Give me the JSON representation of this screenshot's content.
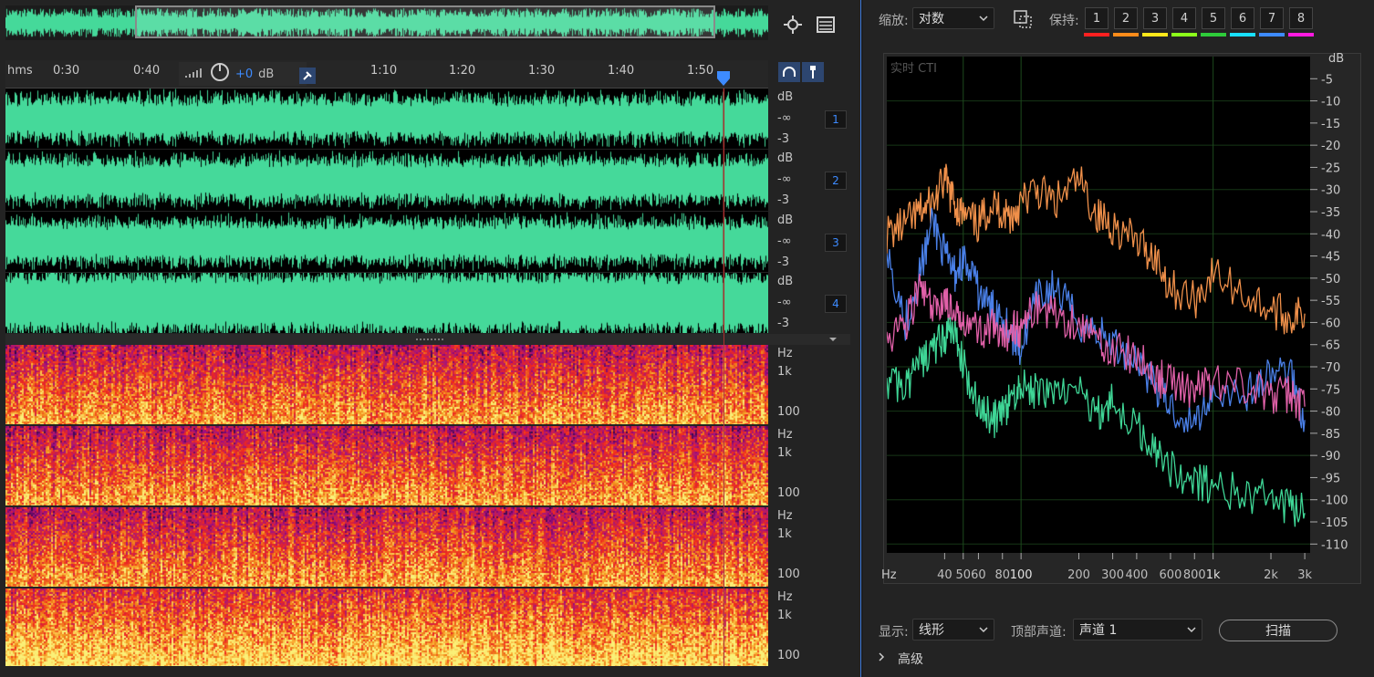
{
  "editor": {
    "ruler": {
      "unit": "hms",
      "ticks": [
        "0:30",
        "0:40",
        "1:10",
        "1:20",
        "1:30",
        "1:40",
        "1:50"
      ]
    },
    "hud": {
      "gain": "+0",
      "unit": "dB"
    },
    "waveform_channels": [
      {
        "number": "1",
        "scale": [
          "dB",
          "-∞",
          "-3"
        ]
      },
      {
        "number": "2",
        "scale": [
          "dB",
          "-∞",
          "-3"
        ]
      },
      {
        "number": "3",
        "scale": [
          "dB",
          "-∞",
          "-3"
        ]
      },
      {
        "number": "4",
        "scale": [
          "dB",
          "-∞",
          "-3"
        ]
      }
    ],
    "spectral_channels": [
      {
        "scale": [
          "Hz",
          "1k",
          "100"
        ]
      },
      {
        "scale": [
          "Hz",
          "1k",
          "100"
        ]
      },
      {
        "scale": [
          "Hz",
          "1k",
          "100"
        ]
      },
      {
        "scale": [
          "Hz",
          "1k",
          "100"
        ]
      }
    ],
    "waveform_color": "#45d99a",
    "icons": [
      "zoom-icon",
      "list-icon",
      "headphones-icon",
      "pin-icon",
      "meter-icon",
      "knob-icon"
    ]
  },
  "analysis": {
    "zoom_label": "缩放:",
    "zoom_value": "对数",
    "hold_label": "保持:",
    "holds": [
      {
        "n": "1",
        "color": "#ff2020"
      },
      {
        "n": "2",
        "color": "#ff8c1a"
      },
      {
        "n": "3",
        "color": "#ffe81a"
      },
      {
        "n": "4",
        "color": "#8cff1a"
      },
      {
        "n": "5",
        "color": "#2ecc3a"
      },
      {
        "n": "6",
        "color": "#18e0ff"
      },
      {
        "n": "7",
        "color": "#3d8bff"
      },
      {
        "n": "8",
        "color": "#ff1ae0"
      }
    ],
    "overlay_text": "实时 CTI",
    "display_label": "显示:",
    "display_value": "线形",
    "top_channel_label": "顶部声道:",
    "top_channel_value": "声道 1",
    "scan_button": "扫描",
    "advanced": "高级"
  },
  "chart_data": {
    "type": "line",
    "xlabel": "Hz",
    "ylabel": "dB",
    "x_scale": "log",
    "x_ticks": [
      "40",
      "50",
      "60",
      "80",
      "100",
      "200",
      "300",
      "400",
      "600",
      "800",
      "1k",
      "2k",
      "3k"
    ],
    "y_ticks": [
      "-5",
      "-10",
      "-15",
      "-20",
      "-25",
      "-30",
      "-35",
      "-40",
      "-45",
      "-50",
      "-55",
      "-60",
      "-65",
      "-70",
      "-75",
      "-80",
      "-85",
      "-90",
      "-95",
      "-100",
      "-105",
      "-110"
    ],
    "xlim": [
      20,
      3200
    ],
    "ylim": [
      -112,
      0
    ],
    "grid": true,
    "series": [
      {
        "color": "#f0904a",
        "x": [
          20,
          25,
          30,
          35,
          40,
          45,
          50,
          60,
          70,
          80,
          90,
          100,
          120,
          150,
          200,
          250,
          300,
          400,
          500,
          600,
          800,
          1000,
          1500,
          2000,
          2500,
          3000
        ],
        "y": [
          -40,
          -38,
          -35,
          -33,
          -28,
          -33,
          -36,
          -38,
          -33,
          -35,
          -36,
          -33,
          -30,
          -33,
          -28,
          -36,
          -38,
          -42,
          -45,
          -52,
          -55,
          -49,
          -54,
          -57,
          -59,
          -58
        ]
      },
      {
        "color": "#4a80e8",
        "x": [
          20,
          25,
          30,
          35,
          40,
          45,
          50,
          60,
          70,
          80,
          90,
          100,
          120,
          150,
          200,
          250,
          300,
          400,
          500,
          600,
          800,
          1000,
          1500,
          2000,
          2500,
          3000
        ],
        "y": [
          -43,
          -60,
          -48,
          -37,
          -45,
          -49,
          -46,
          -53,
          -57,
          -58,
          -63,
          -66,
          -55,
          -52,
          -60,
          -62,
          -65,
          -68,
          -74,
          -79,
          -83,
          -75,
          -76,
          -72,
          -70,
          -82
        ]
      },
      {
        "color": "#e060a8",
        "x": [
          20,
          25,
          30,
          35,
          40,
          45,
          50,
          60,
          70,
          80,
          90,
          100,
          120,
          150,
          200,
          250,
          300,
          400,
          500,
          600,
          800,
          1000,
          1500,
          2000,
          2500,
          3000
        ],
        "y": [
          -63,
          -60,
          -52,
          -58,
          -54,
          -60,
          -58,
          -62,
          -61,
          -65,
          -60,
          -62,
          -56,
          -58,
          -60,
          -64,
          -66,
          -68,
          -72,
          -74,
          -75,
          -73,
          -74,
          -77,
          -76,
          -79
        ]
      },
      {
        "color": "#3fd696",
        "x": [
          20,
          25,
          30,
          35,
          40,
          45,
          50,
          60,
          70,
          80,
          90,
          100,
          120,
          150,
          200,
          250,
          300,
          400,
          500,
          600,
          800,
          1000,
          1500,
          2000,
          2500,
          3000
        ],
        "y": [
          -73,
          -75,
          -69,
          -66,
          -63,
          -62,
          -70,
          -78,
          -82,
          -81,
          -77,
          -74,
          -76,
          -75,
          -76,
          -80,
          -78,
          -84,
          -88,
          -93,
          -96,
          -97,
          -99,
          -100,
          -102,
          -103
        ]
      }
    ]
  }
}
